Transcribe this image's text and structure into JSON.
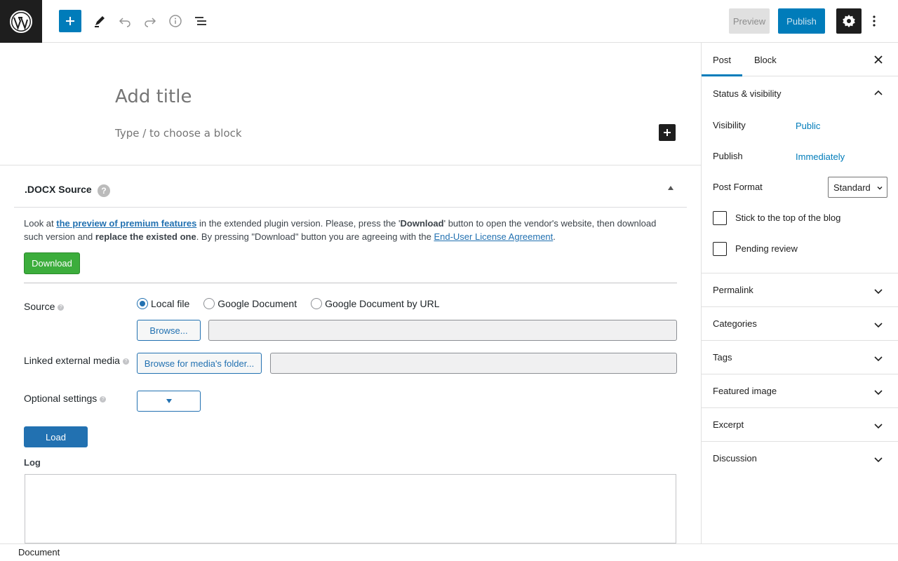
{
  "toolbar": {
    "logo_icon": "wordpress-logo-icon",
    "add_block_icon": "plus-icon",
    "tools_icon": "pencil-icon",
    "undo_icon": "undo-icon",
    "redo_icon": "redo-icon",
    "details_icon": "info-icon",
    "list_view_icon": "list-view-icon",
    "preview_label": "Preview",
    "publish_label": "Publish",
    "settings_icon": "gear-icon",
    "more_icon": "more-vertical-icon"
  },
  "editor": {
    "title_placeholder": "Add title",
    "block_placeholder": "Type / to choose a block"
  },
  "metabox": {
    "title": ".DOCX Source",
    "help_glyph": "?",
    "notice": {
      "p1": "Look at ",
      "link1": "the preview of premium features",
      "p2": " in the extended plugin version. Please, press the '",
      "b1": "Download",
      "p3": "' button to open the vendor's website, then download such version and ",
      "b2": "replace the existed one",
      "p4": ". By pressing \"Download\" button you are agreeing with the ",
      "link2": "End-User License Agreement",
      "p5": "."
    },
    "download_label": "Download",
    "source_label": "Source",
    "source_options": [
      "Local file",
      "Google Document",
      "Google Document by URL"
    ],
    "source_selected": "Local file",
    "browse_label": "Browse...",
    "linked_media_label": "Linked external media",
    "browse_media_label": "Browse for media's folder...",
    "optional_settings_label": "Optional settings",
    "load_label": "Load",
    "log_label": "Log"
  },
  "footer": {
    "breadcrumb": "Document"
  },
  "sidebar": {
    "tabs": [
      "Post",
      "Block"
    ],
    "active_tab": "Post",
    "status_panel": {
      "title": "Status & visibility",
      "visibility_label": "Visibility",
      "visibility_value": "Public",
      "publish_label": "Publish",
      "publish_value": "Immediately",
      "post_format_label": "Post Format",
      "post_format_value": "Standard",
      "sticky_label": "Stick to the top of the blog",
      "pending_label": "Pending review"
    },
    "panels": [
      "Permalink",
      "Categories",
      "Tags",
      "Featured image",
      "Excerpt",
      "Discussion"
    ]
  },
  "colors": {
    "accent": "#007cba",
    "download_green": "#3cad3c",
    "link": "#2271b1"
  }
}
